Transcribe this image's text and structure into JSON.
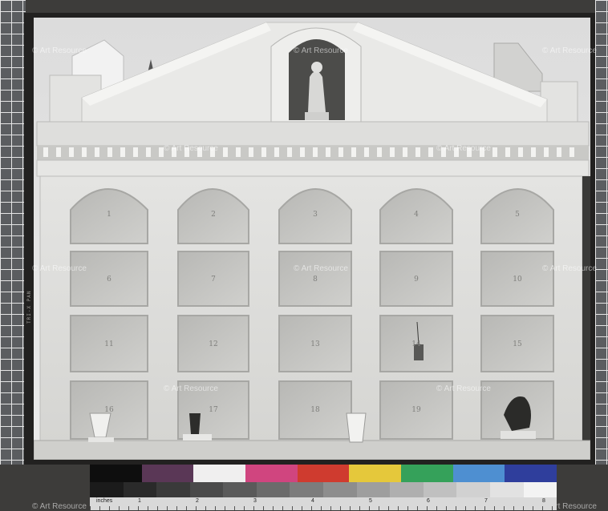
{
  "watermark": {
    "text": "© Art Resource"
  },
  "film_edge_code": "TRI-X PAN",
  "niche_numbers": [
    "1",
    "2",
    "3",
    "4",
    "5",
    "6",
    "7",
    "8",
    "9",
    "10",
    "11",
    "12",
    "13",
    "14",
    "15",
    "16",
    "17",
    "18",
    "19"
  ],
  "color_target": {
    "colors": [
      "#0e0e0e",
      "#5a3756",
      "#f0efef",
      "#d0457f",
      "#cf3b2f",
      "#e5c83b",
      "#35a15a",
      "#4e8fd1",
      "#2f3e9c"
    ],
    "grays": [
      "#1b1b1b",
      "#2a2a2a",
      "#3a3a3a",
      "#4a4a4a",
      "#5a5a5a",
      "#6b6b6b",
      "#7c7c7c",
      "#8d8d8d",
      "#9e9e9e",
      "#afafaf",
      "#c0c0c0",
      "#d1d1d1",
      "#e2e2e2",
      "#f3f3f3"
    ],
    "ruler_label": "inches",
    "ruler_numbers": [
      "1",
      "2",
      "3",
      "4",
      "5",
      "6",
      "7",
      "8"
    ]
  }
}
